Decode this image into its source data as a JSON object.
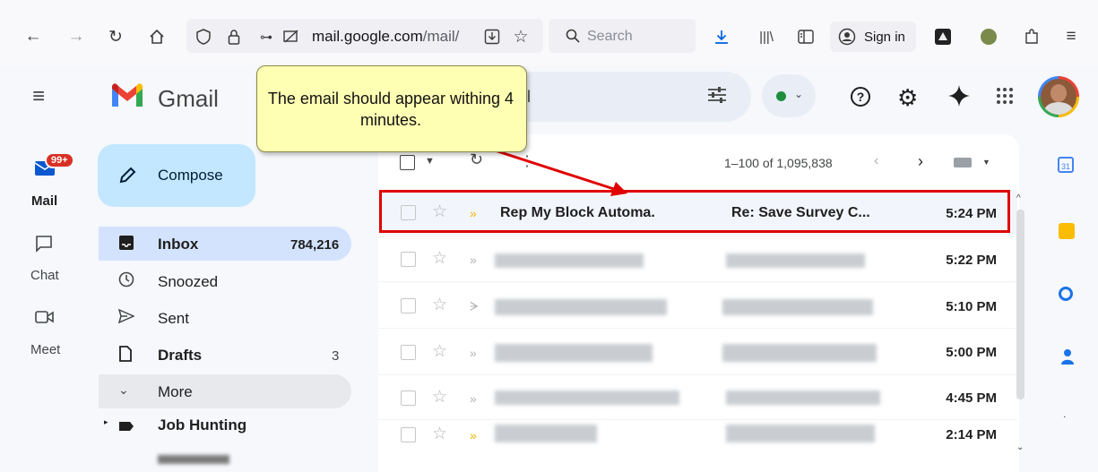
{
  "browser": {
    "url_domain": "mail.google.com",
    "url_rest": "/mail/",
    "search_placeholder": "Search",
    "sign_in_label": "Sign in"
  },
  "gmail": {
    "logo_text": "Gmail",
    "search_value": "il",
    "compose_label": "Compose",
    "rail": [
      {
        "label": "Mail",
        "badge": "99+"
      },
      {
        "label": "Chat"
      },
      {
        "label": "Meet"
      }
    ],
    "nav": [
      {
        "label": "Inbox",
        "count": "784,216",
        "bold": true
      },
      {
        "label": "Snoozed",
        "count": ""
      },
      {
        "label": "Sent",
        "count": ""
      },
      {
        "label": "Drafts",
        "count": "3",
        "bold": true
      },
      {
        "label": "More",
        "count": ""
      },
      {
        "label": "Job Hunting",
        "count": ""
      }
    ],
    "pagination": "1–100 of 1,095,838",
    "emails": [
      {
        "sender": "Rep My Block Automa.",
        "subject": "Re: Save Survey C...",
        "time": "5:24 PM"
      },
      {
        "sender": "",
        "subject": "",
        "time": "5:22 PM"
      },
      {
        "sender": "",
        "subject": "",
        "time": "5:10 PM"
      },
      {
        "sender": "",
        "subject": "",
        "time": "5:00 PM"
      },
      {
        "sender": "",
        "subject": "",
        "time": "4:45 PM"
      },
      {
        "sender": "",
        "subject": "",
        "time": "2:14 PM"
      }
    ]
  },
  "annotation": {
    "callout_text": "The email should appear withing 4 minutes.",
    "highlight_color": "#e00000",
    "callout_color": "#ffffb3"
  },
  "colors": {
    "compose_bg": "#c2e7ff",
    "inbox_selected": "#d3e3fd",
    "badge_red": "#d93025",
    "status_green": "#1e8e3e"
  }
}
